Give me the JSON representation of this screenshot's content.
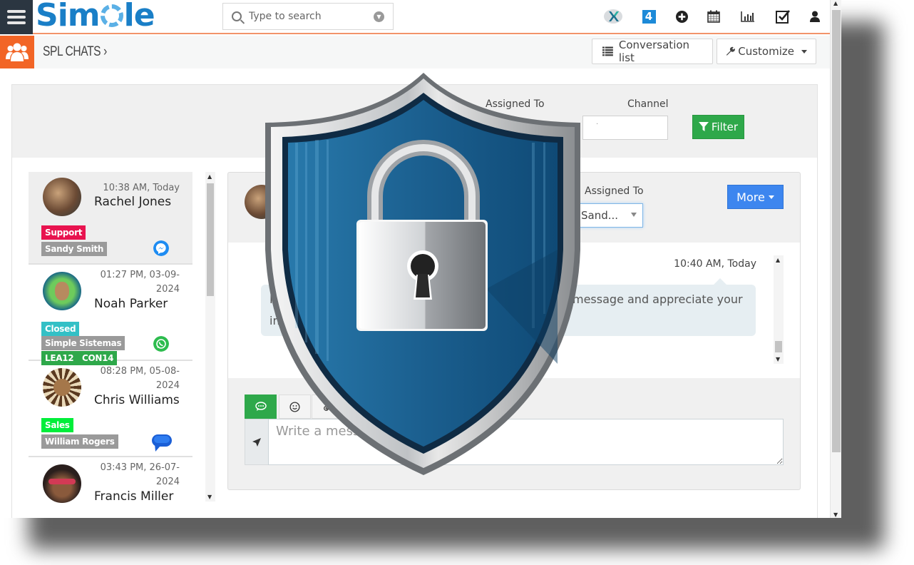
{
  "header": {
    "logo_text_pre": "Sim",
    "logo_text_post": "le",
    "search_placeholder": "Type to search",
    "icons": [
      "x-app-icon",
      "badge-four-icon",
      "plus-circle-icon",
      "calendar-icon",
      "bar-chart-icon",
      "checkbox-icon",
      "user-icon"
    ],
    "badge_number": "4"
  },
  "subheader": {
    "breadcrumb": "SPL CHATS",
    "breadcrumb_chevron": "›",
    "conversation_list_label": "Conversation list",
    "customize_label": "Customize"
  },
  "filters": {
    "assigned_to_label": "Assigned To",
    "channel_label": "Channel",
    "channel_value": "·",
    "filter_button": "Filter"
  },
  "contacts": [
    {
      "name": "Rachel Jones",
      "time": "10:38 AM, Today",
      "tags": [
        {
          "label": "Support",
          "color": "#e8134f"
        },
        {
          "label": "Sandy Smith",
          "color": "#9a9a9a"
        }
      ],
      "channel": "messenger",
      "active": true
    },
    {
      "name": "Noah Parker",
      "time": "01:27 PM, 03-09-2024",
      "tags": [
        {
          "label": "Closed",
          "color": "#33c0c6"
        },
        {
          "label": "Simple Sistemas",
          "color": "#9a9a9a"
        },
        {
          "label": "LEA12   CON14",
          "color": "#2ea84a"
        }
      ],
      "channel": "whatsapp",
      "active": false
    },
    {
      "name": "Chris Williams",
      "time": "08:28 PM, 05-08-2024",
      "tags": [
        {
          "label": "Sales",
          "color": "#00ee3a"
        },
        {
          "label": "William Rogers",
          "color": "#9a9a9a"
        }
      ],
      "channel": "google-messages",
      "active": false
    },
    {
      "name": "Francis Miller",
      "time": "03:43 PM, 26-07-2024",
      "tags": [],
      "channel": "",
      "active": false
    }
  ],
  "chat": {
    "assigned_to_label": "Assigned To",
    "assigned_to_value": "Sand...",
    "more_button": "More",
    "message_time": "10:40 AM, Today",
    "message_line1_start": "H",
    "message_line1_end": "message and appreciate your",
    "message_line2_start": "int",
    "compose_placeholder": "Write a message..."
  },
  "overlay": {
    "semantic": "security-shield-padlock"
  },
  "colors": {
    "topbar_dark": "#2b3641",
    "brand_orange": "#f26526",
    "brand_blue": "#1a7fc7",
    "filter_green": "#2ea84a",
    "more_blue": "#3d86ef",
    "shield_blue": "#1c6494"
  }
}
